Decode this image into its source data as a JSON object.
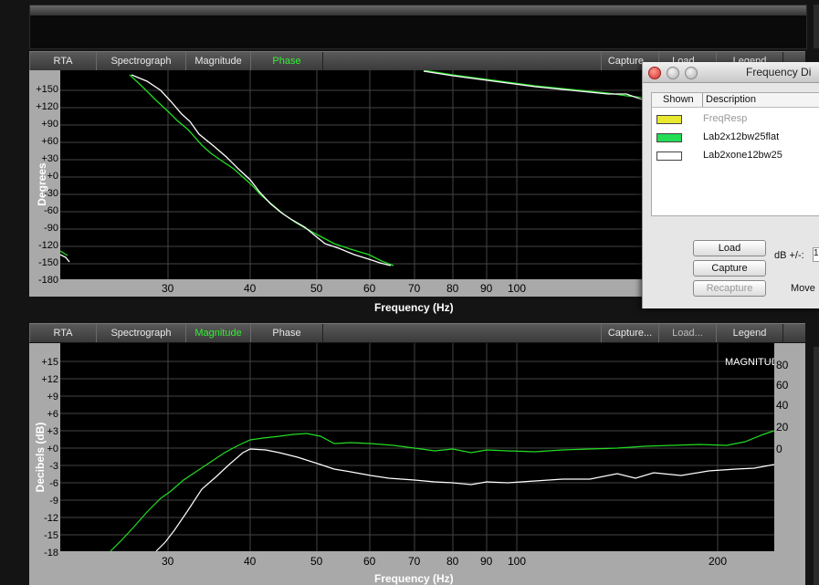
{
  "top_tabs": {
    "rta": "RTA",
    "spectrograph": "Spectrograph",
    "magnitude": "Magnitude",
    "phase": "Phase",
    "capture": "Capture...",
    "load": "Load...",
    "legend": "Legend"
  },
  "phase_graph": {
    "ylabel": "Degrees",
    "xlabel": "Frequency (Hz)",
    "y_ticks": [
      "+150",
      "+120",
      "+90",
      "+60",
      "+30",
      "+0",
      "-30",
      "-60",
      "-90",
      "-120",
      "-150",
      "-180"
    ],
    "x_ticks": [
      "30",
      "40",
      "50",
      "60",
      "70",
      "80",
      "90",
      "100"
    ]
  },
  "bottom_tabs": {
    "rta": "RTA",
    "spectrograph": "Spectrograph",
    "magnitude": "Magnitude",
    "phase": "Phase",
    "capture": "Capture...",
    "load": "Load...",
    "legend": "Legend"
  },
  "magnitude_graph": {
    "title": "MAGNITUDE",
    "ylabel": "Decibels (dB)",
    "xlabel": "Frequency (Hz)",
    "y_ticks": [
      "+15",
      "+12",
      "+9",
      "+6",
      "+3",
      "+0",
      "-3",
      "-6",
      "-9",
      "-12",
      "-15",
      "-18"
    ],
    "y2_ticks": [
      "80",
      "60",
      "40",
      "20",
      "0"
    ],
    "x_ticks": [
      "30",
      "40",
      "50",
      "60",
      "70",
      "80",
      "90",
      "100",
      "200"
    ]
  },
  "dialog": {
    "title": "Frequency Di",
    "col_shown": "Shown",
    "col_description": "Description",
    "rows": [
      {
        "label": "FreqResp",
        "color": "#e8e830",
        "active": false
      },
      {
        "label": "Lab2x12bw25flat",
        "color": "#22dd55",
        "active": true
      },
      {
        "label": "Lab2xone12bw25",
        "color": "#ffffff",
        "active": true
      }
    ],
    "load": "Load",
    "capture": "Capture",
    "recapture": "Recapture",
    "db_label": "dB +/-:",
    "db_value": "1",
    "move": "Move"
  },
  "colors": {
    "green_trace": "#22dd22",
    "white_trace": "#ffffff",
    "accent_tab": "#33ee33"
  }
}
